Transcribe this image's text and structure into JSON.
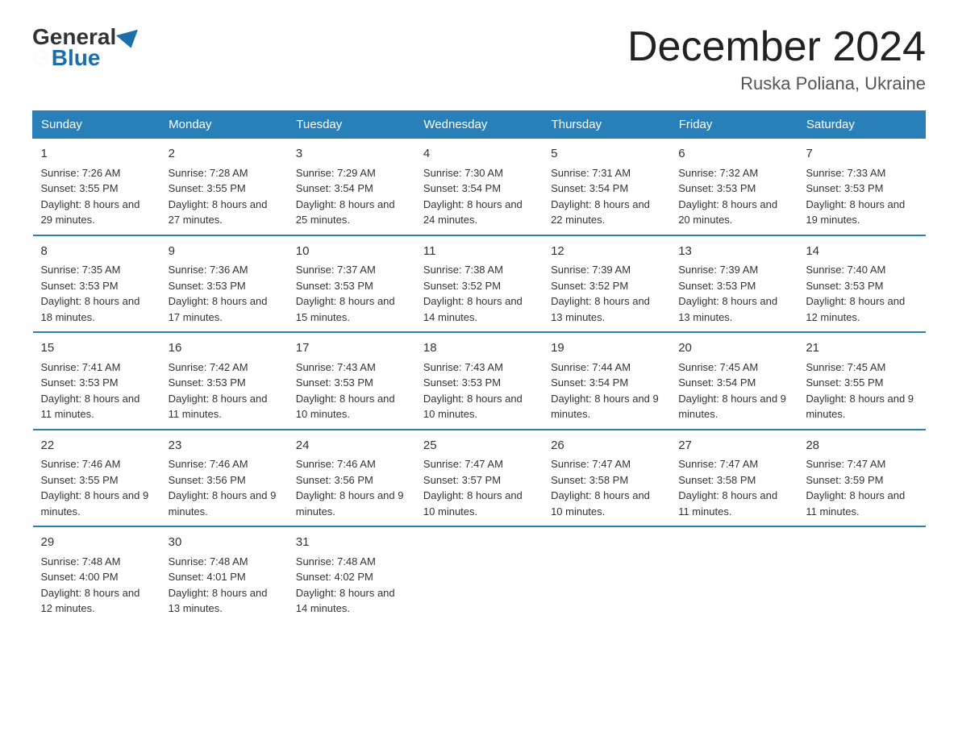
{
  "logo": {
    "general": "General",
    "blue": "Blue"
  },
  "title": "December 2024",
  "subtitle": "Ruska Poliana, Ukraine",
  "days_of_week": [
    "Sunday",
    "Monday",
    "Tuesday",
    "Wednesday",
    "Thursday",
    "Friday",
    "Saturday"
  ],
  "weeks": [
    [
      {
        "day": "1",
        "sunrise": "7:26 AM",
        "sunset": "3:55 PM",
        "daylight": "8 hours and 29 minutes."
      },
      {
        "day": "2",
        "sunrise": "7:28 AM",
        "sunset": "3:55 PM",
        "daylight": "8 hours and 27 minutes."
      },
      {
        "day": "3",
        "sunrise": "7:29 AM",
        "sunset": "3:54 PM",
        "daylight": "8 hours and 25 minutes."
      },
      {
        "day": "4",
        "sunrise": "7:30 AM",
        "sunset": "3:54 PM",
        "daylight": "8 hours and 24 minutes."
      },
      {
        "day": "5",
        "sunrise": "7:31 AM",
        "sunset": "3:54 PM",
        "daylight": "8 hours and 22 minutes."
      },
      {
        "day": "6",
        "sunrise": "7:32 AM",
        "sunset": "3:53 PM",
        "daylight": "8 hours and 20 minutes."
      },
      {
        "day": "7",
        "sunrise": "7:33 AM",
        "sunset": "3:53 PM",
        "daylight": "8 hours and 19 minutes."
      }
    ],
    [
      {
        "day": "8",
        "sunrise": "7:35 AM",
        "sunset": "3:53 PM",
        "daylight": "8 hours and 18 minutes."
      },
      {
        "day": "9",
        "sunrise": "7:36 AM",
        "sunset": "3:53 PM",
        "daylight": "8 hours and 17 minutes."
      },
      {
        "day": "10",
        "sunrise": "7:37 AM",
        "sunset": "3:53 PM",
        "daylight": "8 hours and 15 minutes."
      },
      {
        "day": "11",
        "sunrise": "7:38 AM",
        "sunset": "3:52 PM",
        "daylight": "8 hours and 14 minutes."
      },
      {
        "day": "12",
        "sunrise": "7:39 AM",
        "sunset": "3:52 PM",
        "daylight": "8 hours and 13 minutes."
      },
      {
        "day": "13",
        "sunrise": "7:39 AM",
        "sunset": "3:53 PM",
        "daylight": "8 hours and 13 minutes."
      },
      {
        "day": "14",
        "sunrise": "7:40 AM",
        "sunset": "3:53 PM",
        "daylight": "8 hours and 12 minutes."
      }
    ],
    [
      {
        "day": "15",
        "sunrise": "7:41 AM",
        "sunset": "3:53 PM",
        "daylight": "8 hours and 11 minutes."
      },
      {
        "day": "16",
        "sunrise": "7:42 AM",
        "sunset": "3:53 PM",
        "daylight": "8 hours and 11 minutes."
      },
      {
        "day": "17",
        "sunrise": "7:43 AM",
        "sunset": "3:53 PM",
        "daylight": "8 hours and 10 minutes."
      },
      {
        "day": "18",
        "sunrise": "7:43 AM",
        "sunset": "3:53 PM",
        "daylight": "8 hours and 10 minutes."
      },
      {
        "day": "19",
        "sunrise": "7:44 AM",
        "sunset": "3:54 PM",
        "daylight": "8 hours and 9 minutes."
      },
      {
        "day": "20",
        "sunrise": "7:45 AM",
        "sunset": "3:54 PM",
        "daylight": "8 hours and 9 minutes."
      },
      {
        "day": "21",
        "sunrise": "7:45 AM",
        "sunset": "3:55 PM",
        "daylight": "8 hours and 9 minutes."
      }
    ],
    [
      {
        "day": "22",
        "sunrise": "7:46 AM",
        "sunset": "3:55 PM",
        "daylight": "8 hours and 9 minutes."
      },
      {
        "day": "23",
        "sunrise": "7:46 AM",
        "sunset": "3:56 PM",
        "daylight": "8 hours and 9 minutes."
      },
      {
        "day": "24",
        "sunrise": "7:46 AM",
        "sunset": "3:56 PM",
        "daylight": "8 hours and 9 minutes."
      },
      {
        "day": "25",
        "sunrise": "7:47 AM",
        "sunset": "3:57 PM",
        "daylight": "8 hours and 10 minutes."
      },
      {
        "day": "26",
        "sunrise": "7:47 AM",
        "sunset": "3:58 PM",
        "daylight": "8 hours and 10 minutes."
      },
      {
        "day": "27",
        "sunrise": "7:47 AM",
        "sunset": "3:58 PM",
        "daylight": "8 hours and 11 minutes."
      },
      {
        "day": "28",
        "sunrise": "7:47 AM",
        "sunset": "3:59 PM",
        "daylight": "8 hours and 11 minutes."
      }
    ],
    [
      {
        "day": "29",
        "sunrise": "7:48 AM",
        "sunset": "4:00 PM",
        "daylight": "8 hours and 12 minutes."
      },
      {
        "day": "30",
        "sunrise": "7:48 AM",
        "sunset": "4:01 PM",
        "daylight": "8 hours and 13 minutes."
      },
      {
        "day": "31",
        "sunrise": "7:48 AM",
        "sunset": "4:02 PM",
        "daylight": "8 hours and 14 minutes."
      },
      null,
      null,
      null,
      null
    ]
  ],
  "labels": {
    "sunrise": "Sunrise:",
    "sunset": "Sunset:",
    "daylight": "Daylight:"
  }
}
